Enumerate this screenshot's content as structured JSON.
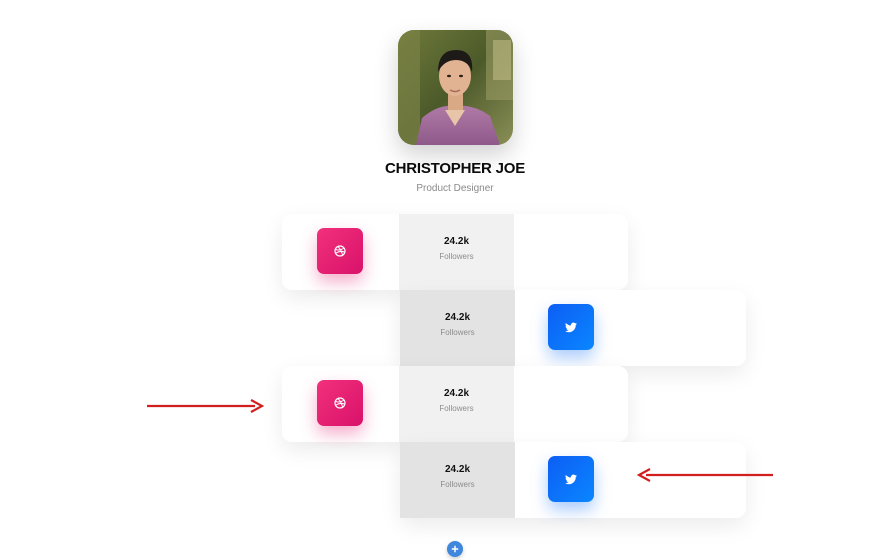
{
  "profile": {
    "name": "CHRISTOPHER JOE",
    "role": "Product Designer"
  },
  "cards": [
    {
      "network": "dribbble",
      "count": "24.2k",
      "label": "Followers",
      "icon": "dribbble-icon"
    },
    {
      "network": "twitter",
      "count": "24.2k",
      "label": "Followers",
      "icon": "twitter-icon"
    },
    {
      "network": "dribbble",
      "count": "24.2k",
      "label": "Followers",
      "icon": "dribbble-icon"
    },
    {
      "network": "twitter",
      "count": "24.2k",
      "label": "Followers",
      "icon": "twitter-icon"
    }
  ],
  "colors": {
    "dribbble": "#e91e76",
    "twitter": "#0a73fa",
    "arrow": "#d11f1f",
    "add_button": "#3f86dc"
  },
  "add_button_icon": "plus-icon"
}
